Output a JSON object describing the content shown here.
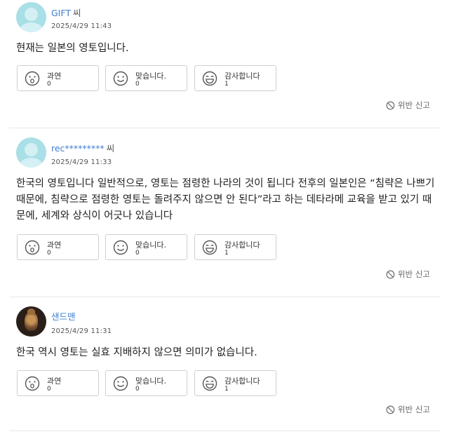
{
  "reaction_labels": [
    "과연",
    "맞습니다.",
    "감사합니다"
  ],
  "report_label": "위반 신고",
  "comments": [
    {
      "name": "GIFT",
      "honorific": "씨",
      "date": "2025/4/29 11:43",
      "text": "현재는 일본의 영토입니다.",
      "counts": [
        "0",
        "0",
        "1"
      ]
    },
    {
      "name": "rec*********",
      "honorific": "씨",
      "date": "2025/4/29 11:33",
      "text": "한국의 영토입니다 일반적으로, 영토는 점령한 나라의 것이 됩니다 전후의 일본인은 “침략은 나쁘기 때문에, 침략으로 점령한 영토는 돌려주지 않으면 안 된다”라고 하는 데타라메 교육을 받고 있기 때문에, 세계와 상식이 어긋나 있습니다",
      "counts": [
        "0",
        "0",
        "1"
      ]
    },
    {
      "name": "샌드맨",
      "honorific": "",
      "date": "2025/4/29 11:31",
      "text": "한국 역시 영토는 실효 지배하지 않으면 의미가 없습니다.",
      "counts": [
        "0",
        "0",
        "1"
      ]
    }
  ]
}
